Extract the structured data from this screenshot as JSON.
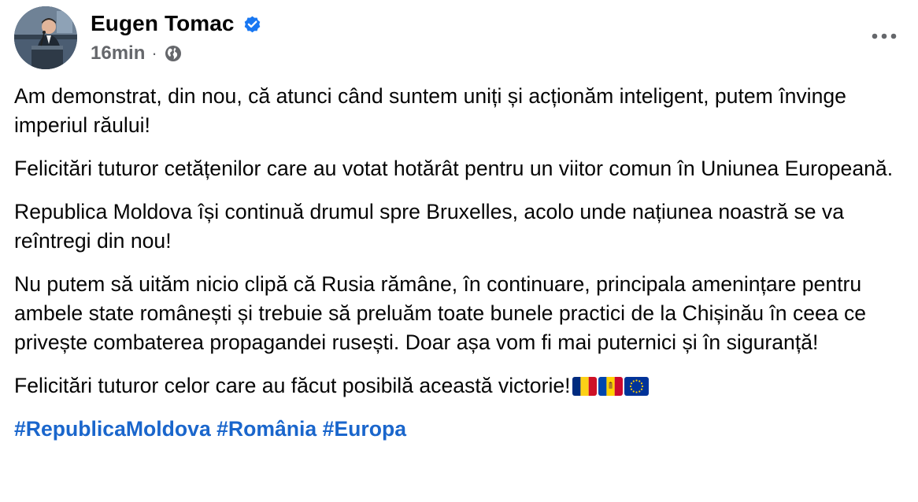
{
  "author": {
    "name": "Eugen Tomac",
    "avatar_icon": "person-at-podium-photo",
    "verified_icon": "verified-badge-icon",
    "verified_color": "#1877f2"
  },
  "meta": {
    "timestamp": "16min",
    "separator": "·",
    "audience_icon": "globe-icon"
  },
  "more_button": {
    "icon": "more-horizontal-icon"
  },
  "post": {
    "paragraphs": [
      "Am demonstrat, din nou, că atunci când suntem uniți și acționăm inteligent, putem învinge imperiul răului!",
      "Felicitări tuturor cetățenilor care au votat hotărât pentru un viitor comun în Uniunea Europeană.",
      "Republica Moldova își continuă drumul spre Bruxelles, acolo unde națiunea noastră se va reîntregi din nou!",
      "Nu putem să uităm nicio clipă că Rusia rămâne, în continuare, principala amenințare pentru ambele state românești și trebuie să preluăm toate bunele practici de la Chișinău în ceea ce privește combaterea propagandei rusești. Doar așa vom fi mai puternici și în siguranță!",
      "Felicitări tuturor celor care au făcut posibilă această victorie!"
    ],
    "flags": [
      "flag-romania-icon",
      "flag-moldova-icon",
      "flag-eu-icon"
    ],
    "hashtags": [
      "#RepublicaMoldova",
      "#România",
      "#Europa"
    ],
    "hashtag_separator": " "
  },
  "colors": {
    "text": "#050505",
    "secondary": "#65676b",
    "link": "#1a66cc",
    "background": "#ffffff"
  }
}
